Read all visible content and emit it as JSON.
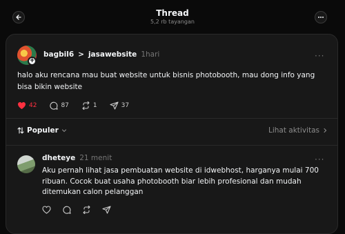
{
  "header": {
    "title": "Thread",
    "views": "5,2 rb tayangan"
  },
  "post": {
    "author": "bagbil6",
    "separator": ">",
    "community": "jasawebsite",
    "time": "1hari",
    "avatar_badge": "+",
    "more": "···",
    "text": "halo aku rencana mau buat website untuk bisnis photobooth, mau dong info yang bisa bikin website",
    "likes": "42",
    "comments": "87",
    "reposts": "1",
    "shares": "37"
  },
  "sort": {
    "label": "Populer",
    "activity_link": "Lihat aktivitas"
  },
  "reply": {
    "author": "dheteye",
    "time": "21 menit",
    "more": "···",
    "text": "Aku pernah lihat jasa pembuatan website di idwebhost, harganya mulai 700 ribuan. Cocok buat usaha photobooth biar lebih profesional dan mudah ditemukan calon pelanggan"
  },
  "colors": {
    "background": "#0a0a0a",
    "panel": "#181818",
    "like_red": "#ff3040",
    "muted": "#8c8c8c"
  },
  "icons": [
    "back-arrow-icon",
    "more-icon",
    "heart-icon",
    "comment-icon",
    "repost-icon",
    "share-icon",
    "sort-icon",
    "chevron-down-icon",
    "chevron-right-icon"
  ]
}
